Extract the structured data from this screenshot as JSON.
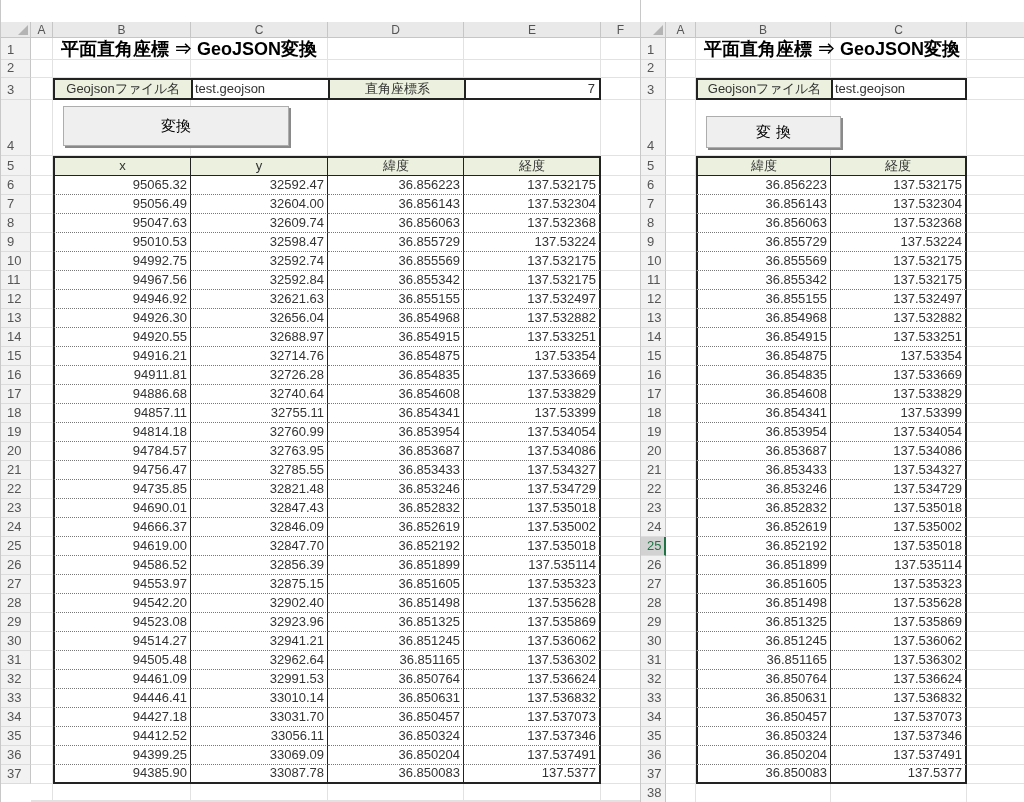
{
  "sheets": [
    {
      "columns": [
        "A",
        "B",
        "C",
        "D",
        "E",
        "F"
      ],
      "row_headers": [
        {
          "label": "1",
          "selected": false
        },
        {
          "label": "2",
          "selected": false
        },
        {
          "label": "3",
          "selected": false
        },
        {
          "label": "4",
          "selected": false
        },
        {
          "label": "5",
          "selected": false
        },
        {
          "label": "6",
          "selected": false
        },
        {
          "label": "7",
          "selected": false
        },
        {
          "label": "8",
          "selected": false
        },
        {
          "label": "9",
          "selected": false
        },
        {
          "label": "10",
          "selected": false
        },
        {
          "label": "11",
          "selected": false
        },
        {
          "label": "12",
          "selected": false
        },
        {
          "label": "13",
          "selected": false
        },
        {
          "label": "14",
          "selected": false
        },
        {
          "label": "15",
          "selected": false
        },
        {
          "label": "16",
          "selected": false
        },
        {
          "label": "17",
          "selected": false
        },
        {
          "label": "18",
          "selected": false
        },
        {
          "label": "19",
          "selected": false
        },
        {
          "label": "20",
          "selected": false
        },
        {
          "label": "21",
          "selected": false
        },
        {
          "label": "22",
          "selected": false
        },
        {
          "label": "23",
          "selected": false
        },
        {
          "label": "24",
          "selected": false
        },
        {
          "label": "25",
          "selected": false
        },
        {
          "label": "26",
          "selected": false
        },
        {
          "label": "27",
          "selected": false
        },
        {
          "label": "28",
          "selected": false
        },
        {
          "label": "29",
          "selected": false
        },
        {
          "label": "30",
          "selected": false
        },
        {
          "label": "31",
          "selected": false
        },
        {
          "label": "32",
          "selected": false
        },
        {
          "label": "33",
          "selected": false
        },
        {
          "label": "34",
          "selected": false
        },
        {
          "label": "35",
          "selected": false
        },
        {
          "label": "36",
          "selected": false
        },
        {
          "label": "37",
          "selected": false
        }
      ],
      "title": "平面直角座標 ⇒ GeoJSON変換",
      "fields": [
        {
          "kind": "label",
          "text": "Geojsonファイル名"
        },
        {
          "kind": "text",
          "text": "test.geojson"
        },
        {
          "kind": "label",
          "text": "直角座標系"
        },
        {
          "kind": "number",
          "text": "7"
        }
      ],
      "button": "変換",
      "table": {
        "columns": [
          "x",
          "y",
          "緯度",
          "経度"
        ],
        "rows": [
          [
            "95065.32",
            "32592.47",
            "36.856223",
            "137.532175"
          ],
          [
            "95056.49",
            "32604.00",
            "36.856143",
            "137.532304"
          ],
          [
            "95047.63",
            "32609.74",
            "36.856063",
            "137.532368"
          ],
          [
            "95010.53",
            "32598.47",
            "36.855729",
            "137.53224"
          ],
          [
            "94992.75",
            "32592.74",
            "36.855569",
            "137.532175"
          ],
          [
            "94967.56",
            "32592.84",
            "36.855342",
            "137.532175"
          ],
          [
            "94946.92",
            "32621.63",
            "36.855155",
            "137.532497"
          ],
          [
            "94926.30",
            "32656.04",
            "36.854968",
            "137.532882"
          ],
          [
            "94920.55",
            "32688.97",
            "36.854915",
            "137.533251"
          ],
          [
            "94916.21",
            "32714.76",
            "36.854875",
            "137.53354"
          ],
          [
            "94911.81",
            "32726.28",
            "36.854835",
            "137.533669"
          ],
          [
            "94886.68",
            "32740.64",
            "36.854608",
            "137.533829"
          ],
          [
            "94857.11",
            "32755.11",
            "36.854341",
            "137.53399"
          ],
          [
            "94814.18",
            "32760.99",
            "36.853954",
            "137.534054"
          ],
          [
            "94784.57",
            "32763.95",
            "36.853687",
            "137.534086"
          ],
          [
            "94756.47",
            "32785.55",
            "36.853433",
            "137.534327"
          ],
          [
            "94735.85",
            "32821.48",
            "36.853246",
            "137.534729"
          ],
          [
            "94690.01",
            "32847.43",
            "36.852832",
            "137.535018"
          ],
          [
            "94666.37",
            "32846.09",
            "36.852619",
            "137.535002"
          ],
          [
            "94619.00",
            "32847.70",
            "36.852192",
            "137.535018"
          ],
          [
            "94586.52",
            "32856.39",
            "36.851899",
            "137.535114"
          ],
          [
            "94553.97",
            "32875.15",
            "36.851605",
            "137.535323"
          ],
          [
            "94542.20",
            "32902.40",
            "36.851498",
            "137.535628"
          ],
          [
            "94523.08",
            "32923.96",
            "36.851325",
            "137.535869"
          ],
          [
            "94514.27",
            "32941.21",
            "36.851245",
            "137.536062"
          ],
          [
            "94505.48",
            "32962.64",
            "36.851165",
            "137.536302"
          ],
          [
            "94461.09",
            "32991.53",
            "36.850764",
            "137.536624"
          ],
          [
            "94446.41",
            "33010.14",
            "36.850631",
            "137.536832"
          ],
          [
            "94427.18",
            "33031.70",
            "36.850457",
            "137.537073"
          ],
          [
            "94412.52",
            "33056.11",
            "36.850324",
            "137.537346"
          ],
          [
            "94399.25",
            "33069.09",
            "36.850204",
            "137.537491"
          ],
          [
            "94385.90",
            "33087.78",
            "36.850083",
            "137.5377"
          ]
        ]
      }
    },
    {
      "columns": [
        "A",
        "B",
        "C"
      ],
      "row_headers": [
        {
          "label": "1",
          "selected": false
        },
        {
          "label": "2",
          "selected": false
        },
        {
          "label": "3",
          "selected": false
        },
        {
          "label": "4",
          "selected": false
        },
        {
          "label": "5",
          "selected": false
        },
        {
          "label": "6",
          "selected": false
        },
        {
          "label": "7",
          "selected": false
        },
        {
          "label": "8",
          "selected": false
        },
        {
          "label": "9",
          "selected": false
        },
        {
          "label": "10",
          "selected": false
        },
        {
          "label": "11",
          "selected": false
        },
        {
          "label": "12",
          "selected": false
        },
        {
          "label": "13",
          "selected": false
        },
        {
          "label": "14",
          "selected": false
        },
        {
          "label": "15",
          "selected": false
        },
        {
          "label": "16",
          "selected": false
        },
        {
          "label": "17",
          "selected": false
        },
        {
          "label": "18",
          "selected": false
        },
        {
          "label": "19",
          "selected": false
        },
        {
          "label": "20",
          "selected": false
        },
        {
          "label": "21",
          "selected": false
        },
        {
          "label": "22",
          "selected": false
        },
        {
          "label": "23",
          "selected": false
        },
        {
          "label": "24",
          "selected": false
        },
        {
          "label": "25",
          "selected": true
        },
        {
          "label": "26",
          "selected": false
        },
        {
          "label": "27",
          "selected": false
        },
        {
          "label": "28",
          "selected": false
        },
        {
          "label": "29",
          "selected": false
        },
        {
          "label": "30",
          "selected": false
        },
        {
          "label": "31",
          "selected": false
        },
        {
          "label": "32",
          "selected": false
        },
        {
          "label": "33",
          "selected": false
        },
        {
          "label": "34",
          "selected": false
        },
        {
          "label": "35",
          "selected": false
        },
        {
          "label": "36",
          "selected": false
        },
        {
          "label": "37",
          "selected": false
        },
        {
          "label": "38",
          "selected": false
        }
      ],
      "title": "平面直角座標 ⇒ GeoJSON変換",
      "fields": [
        {
          "kind": "label",
          "text": "Geojsonファイル名"
        },
        {
          "kind": "text",
          "text": "test.geojson"
        }
      ],
      "button": "変 換",
      "table": {
        "columns": [
          "緯度",
          "経度"
        ],
        "rows": [
          [
            "36.856223",
            "137.532175"
          ],
          [
            "36.856143",
            "137.532304"
          ],
          [
            "36.856063",
            "137.532368"
          ],
          [
            "36.855729",
            "137.53224"
          ],
          [
            "36.855569",
            "137.532175"
          ],
          [
            "36.855342",
            "137.532175"
          ],
          [
            "36.855155",
            "137.532497"
          ],
          [
            "36.854968",
            "137.532882"
          ],
          [
            "36.854915",
            "137.533251"
          ],
          [
            "36.854875",
            "137.53354"
          ],
          [
            "36.854835",
            "137.533669"
          ],
          [
            "36.854608",
            "137.533829"
          ],
          [
            "36.854341",
            "137.53399"
          ],
          [
            "36.853954",
            "137.534054"
          ],
          [
            "36.853687",
            "137.534086"
          ],
          [
            "36.853433",
            "137.534327"
          ],
          [
            "36.853246",
            "137.534729"
          ],
          [
            "36.852832",
            "137.535018"
          ],
          [
            "36.852619",
            "137.535002"
          ],
          [
            "36.852192",
            "137.535018"
          ],
          [
            "36.851899",
            "137.535114"
          ],
          [
            "36.851605",
            "137.535323"
          ],
          [
            "36.851498",
            "137.535628"
          ],
          [
            "36.851325",
            "137.535869"
          ],
          [
            "36.851245",
            "137.536062"
          ],
          [
            "36.851165",
            "137.536302"
          ],
          [
            "36.850764",
            "137.536624"
          ],
          [
            "36.850631",
            "137.536832"
          ],
          [
            "36.850457",
            "137.537073"
          ],
          [
            "36.850324",
            "137.537346"
          ],
          [
            "36.850204",
            "137.537491"
          ],
          [
            "36.850083",
            "137.5377"
          ]
        ]
      }
    }
  ]
}
